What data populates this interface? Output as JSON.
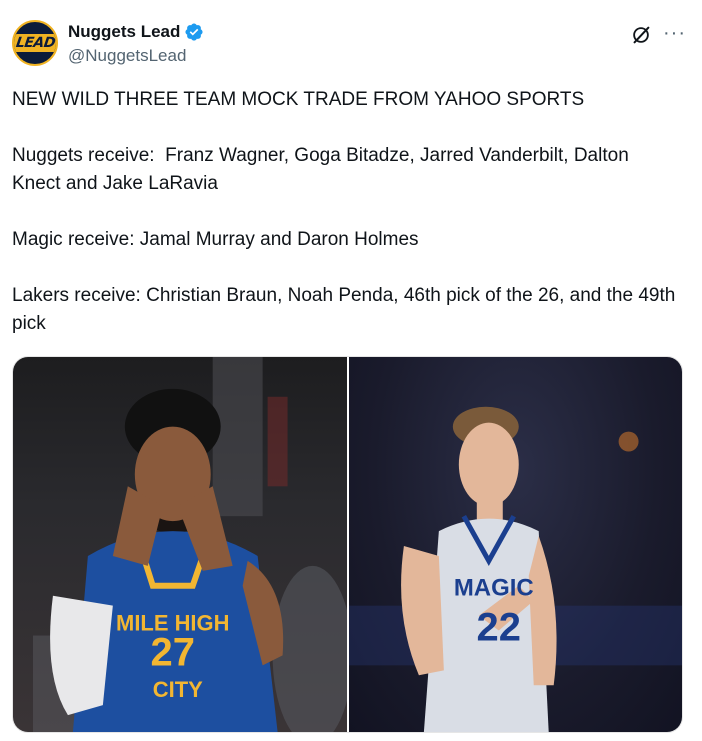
{
  "account": {
    "display_name": "Nuggets Lead",
    "handle": "@NuggetsLead",
    "avatar_text": "LEAD",
    "verified": true
  },
  "tweet": {
    "text": "NEW WILD THREE TEAM MOCK TRADE FROM YAHOO SPORTS\n\nNuggets receive:  Franz Wagner, Goga Bitadze, Jarred Vanderbilt, Dalton Knect and Jake LaRavia\n\nMagic receive: Jamal Murray and Daron Holmes\n\nLakers receive: Christian Braun, Noah Penda, 46th pick of the 26, and the 49th pick"
  },
  "media": {
    "left_photo": {
      "jersey_lines": [
        "MILE HIGH",
        "27",
        "CITY"
      ],
      "jersey_color": "#1d4fa0",
      "accent_color": "#f2b632"
    },
    "right_photo": {
      "jersey_lines": [
        "MAGIC",
        "22"
      ],
      "jersey_color": "#d9dde5",
      "accent_color": "#1b3f8f"
    }
  },
  "icons": {
    "verified": "verified-badge-icon",
    "grok": "grok-icon",
    "more": "more-options-icon"
  },
  "colors": {
    "verified_blue": "#1d9bf0",
    "text": "#0f1419",
    "secondary": "#536471"
  }
}
